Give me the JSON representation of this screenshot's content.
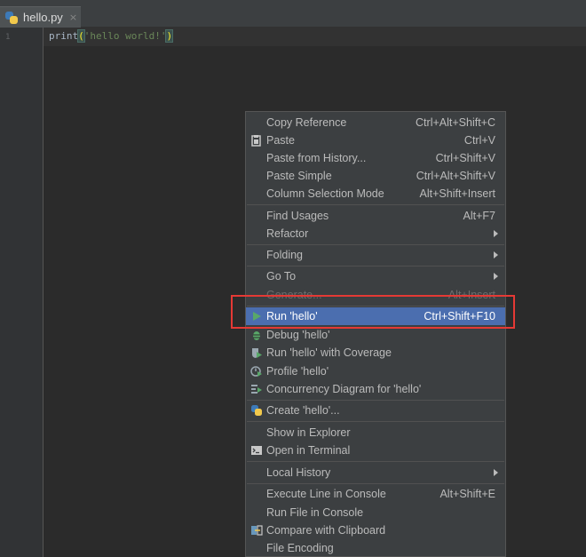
{
  "tab": {
    "filename": "hello.py",
    "close": "×"
  },
  "editor": {
    "line_number": "1",
    "code": {
      "fn": "print",
      "open": "(",
      "string": "'hello world!'",
      "close": ")"
    }
  },
  "context_menu": {
    "items": [
      {
        "label": "Copy Reference",
        "shortcut": "Ctrl+Alt+Shift+C"
      },
      {
        "label": "Paste",
        "shortcut": "Ctrl+V",
        "icon": "paste-icon"
      },
      {
        "label": "Paste from History...",
        "shortcut": "Ctrl+Shift+V"
      },
      {
        "label": "Paste Simple",
        "shortcut": "Ctrl+Alt+Shift+V"
      },
      {
        "label": "Column Selection Mode",
        "shortcut": "Alt+Shift+Insert"
      },
      {
        "label": "Find Usages",
        "shortcut": "Alt+F7"
      },
      {
        "label": "Refactor",
        "submenu": true
      },
      {
        "label": "Folding",
        "submenu": true
      },
      {
        "label": "Go To",
        "submenu": true
      },
      {
        "label": "Generate...",
        "shortcut": "Alt+Insert",
        "disabled": true
      },
      {
        "label": "Run 'hello'",
        "shortcut": "Ctrl+Shift+F10",
        "icon": "run-icon",
        "selected": true
      },
      {
        "label": "Debug 'hello'",
        "icon": "debug-icon"
      },
      {
        "label": "Run 'hello' with Coverage",
        "icon": "coverage-icon"
      },
      {
        "label": "Profile 'hello'",
        "icon": "profile-icon"
      },
      {
        "label": "Concurrency Diagram for 'hello'",
        "icon": "concurrency-icon"
      },
      {
        "label": "Create 'hello'...",
        "icon": "python-icon"
      },
      {
        "label": "Show in Explorer"
      },
      {
        "label": "Open in Terminal",
        "icon": "terminal-icon"
      },
      {
        "label": "Local History",
        "submenu": true
      },
      {
        "label": "Execute Line in Console",
        "shortcut": "Alt+Shift+E"
      },
      {
        "label": "Run File in Console"
      },
      {
        "label": "Compare with Clipboard",
        "icon": "compare-icon"
      },
      {
        "label": "File Encoding"
      }
    ]
  },
  "colors": {
    "selection": "#4b6eaf",
    "annotation_box": "#e53935",
    "menu_bg": "#3c3f41",
    "editor_bg": "#2b2b2b"
  }
}
